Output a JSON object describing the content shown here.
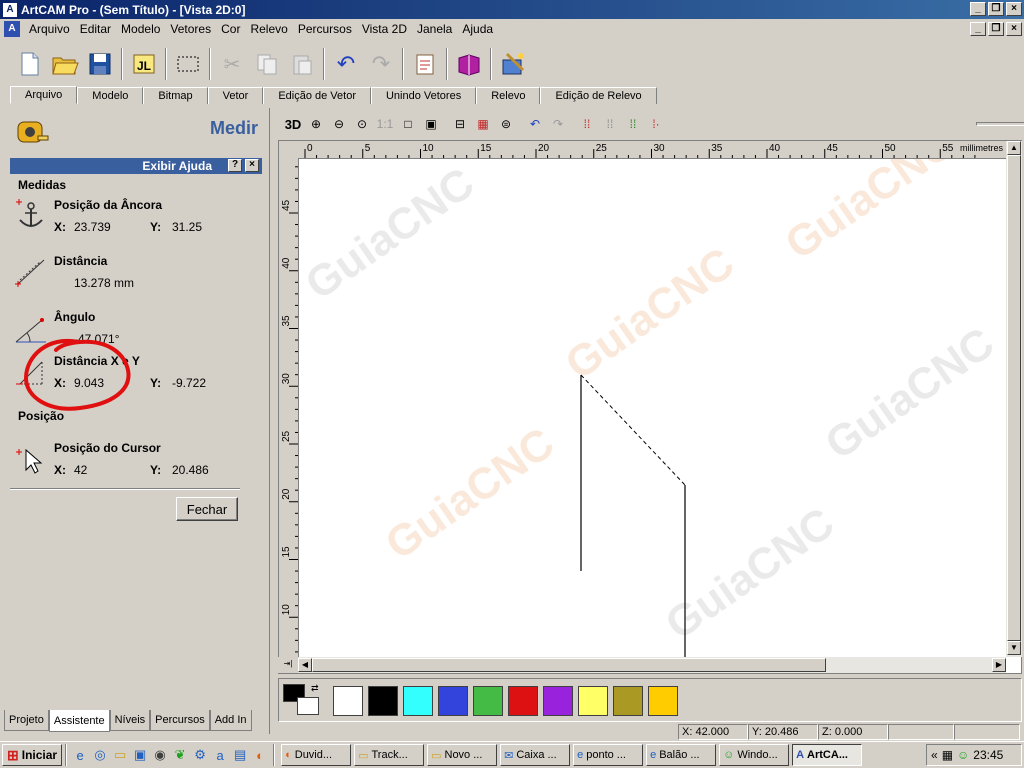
{
  "window": {
    "title": "ArtCAM Pro - (Sem Título) - [Vista 2D:0]"
  },
  "menu": [
    "Arquivo",
    "Editar",
    "Modelo",
    "Vetores",
    "Cor",
    "Relevo",
    "Percursos",
    "Vista 2D",
    "Janela",
    "Ajuda"
  ],
  "tabs": [
    "Arquivo",
    "Modelo",
    "Bitmap",
    "Vetor",
    "Edição de Vetor",
    "Unindo Vetores",
    "Relevo",
    "Edição de Relevo"
  ],
  "panel": {
    "title": "Medir",
    "help_bar": "Exibir Ajuda",
    "section_measures": "Medidas",
    "anchor": {
      "title": "Posição da Âncora",
      "x_label": "X:",
      "x": "23.739",
      "y_label": "Y:",
      "y": "31.25"
    },
    "distance": {
      "title": "Distância",
      "value": "13.278 mm"
    },
    "angle": {
      "title": "Ângulo",
      "value": "-47.071°"
    },
    "xy_distance": {
      "title": "Distância X e Y",
      "x_label": "X:",
      "x": "9.043",
      "y_label": "Y:",
      "y": "-9.722"
    },
    "section_position": "Posição",
    "cursor": {
      "title": "Posição do Cursor",
      "x_label": "X:",
      "x": "42",
      "y_label": "Y:",
      "y": "20.486"
    },
    "close_button": "Fechar"
  },
  "bottom_tabs": [
    "Projeto",
    "Assistente",
    "Níveis",
    "Percursos",
    "Add In"
  ],
  "view": {
    "toolbar_3d": "3D",
    "toolbar_11": "1:1",
    "units": "millimetres",
    "hruler_labels": [
      "0",
      "5",
      "10",
      "15",
      "20",
      "25",
      "30",
      "35",
      "40",
      "45",
      "50",
      "55"
    ],
    "vruler_labels": [
      "45",
      "40",
      "35",
      "30",
      "25",
      "20",
      "15",
      "10"
    ]
  },
  "palette": {
    "colors": [
      "#ffffff",
      "#000000",
      "#33ffff",
      "#3344dd",
      "#44bb44",
      "#dd1111",
      "#9922dd",
      "#ffff66",
      "#aa9922",
      "#ffcc00"
    ]
  },
  "status": {
    "x": "X: 42.000",
    "y": "Y: 20.486",
    "z": "Z: 0.000"
  },
  "taskbar": {
    "start": "Iniciar",
    "tasks": [
      "Duvid...",
      "Track...",
      "Novo ...",
      "Caixa ...",
      "ponto ...",
      "Balão ...",
      "Windo...",
      "ArtCA..."
    ],
    "clock": "23:45"
  },
  "watermark": "GuiaCNC"
}
